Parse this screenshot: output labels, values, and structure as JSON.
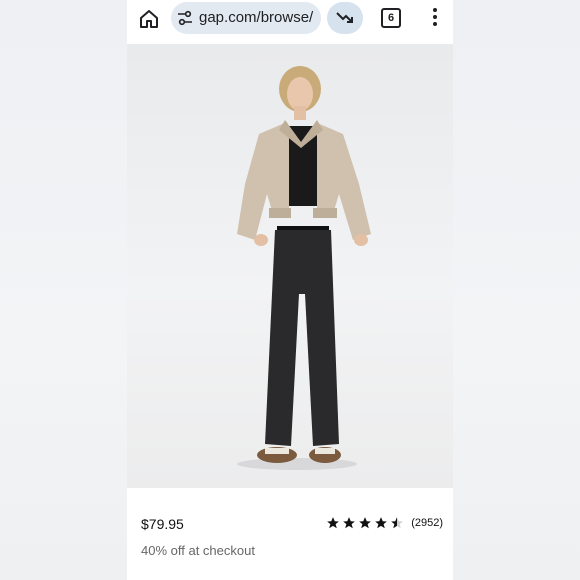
{
  "browser": {
    "url": "gap.com/browse/",
    "tab_count": "6"
  },
  "product": {
    "price": "$79.95",
    "rating": 4.5,
    "rating_count": "(2952)",
    "promo": "40% off at checkout",
    "image_description": "model wearing cropped beige jacket, black top and black wide-leg jeans"
  },
  "icons": {
    "home": "home-icon",
    "site_settings": "tune-icon",
    "trending": "trending-down-icon",
    "tabs": "tab-switcher-icon",
    "menu": "more-vert-icon",
    "star": "star-icon"
  },
  "colors": {
    "omnibox_bg": "#e3e9f1",
    "trend_bg": "#d6e2ee",
    "star": "#111111",
    "promo_text": "#666666"
  }
}
